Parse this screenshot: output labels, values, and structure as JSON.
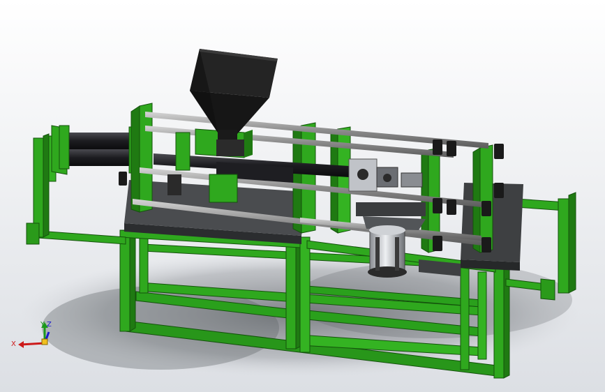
{
  "triad": {
    "x_label": "X",
    "y_label": "Y",
    "z_label": "Z",
    "x_color": "#cc1a1a",
    "y_color": "#1a9a1a",
    "z_color": "#1a1acc"
  },
  "colors": {
    "background_top": "#ffffff",
    "background_bottom": "#dcdfe4",
    "frame_green": "#2fa81e",
    "frame_green_dark": "#1a6a10",
    "frame_green_light": "#5fd34a",
    "plate_dark": "#3a3c3e",
    "rod_gray": "#9a9a9a",
    "hopper_black": "#1c1c1c",
    "cylinder_black": "#1e1e22",
    "chrome": "#c8cbd0"
  }
}
